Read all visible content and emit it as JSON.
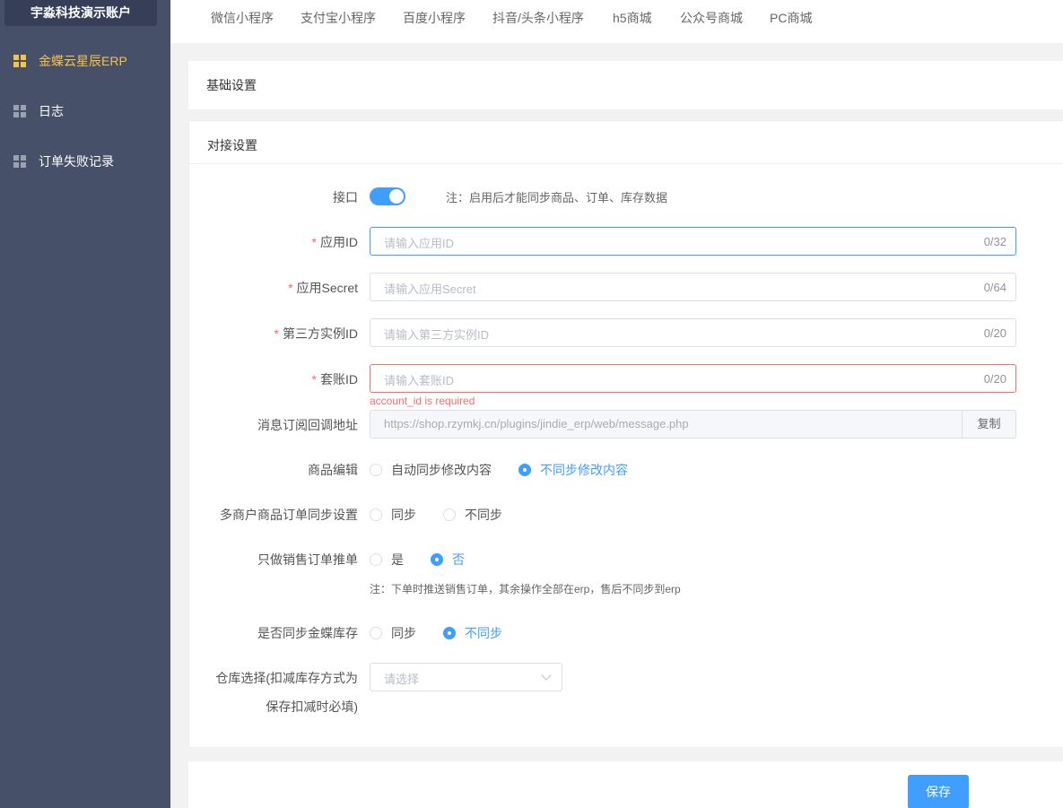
{
  "sidebar": {
    "account": "宇淼科技演示账户",
    "items": [
      {
        "label": "金蝶云星辰ERP"
      },
      {
        "label": "日志"
      },
      {
        "label": "订单失败记录"
      }
    ]
  },
  "tabs": [
    "微信小程序",
    "支付宝小程序",
    "百度小程序",
    "抖音/头条小程序",
    "h5商城",
    "公众号商城",
    "PC商城"
  ],
  "basic": {
    "title": "基础设置"
  },
  "dock": {
    "title": "对接设置",
    "interface": {
      "label": "接口",
      "note": "注：启用后才能同步商品、订单、库存数据"
    },
    "app_id": {
      "label": "应用ID",
      "placeholder": "请输入应用ID",
      "count": "0/32"
    },
    "app_secret": {
      "label": "应用Secret",
      "placeholder": "请输入应用Secret",
      "count": "0/64"
    },
    "instance_id": {
      "label": "第三方实例ID",
      "placeholder": "请输入第三方实例ID",
      "count": "0/20"
    },
    "account_id": {
      "label": "套账ID",
      "placeholder": "请输入套账ID",
      "count": "0/20",
      "error": "account_id is required"
    },
    "callback": {
      "label": "消息订阅回调地址",
      "value": "https://shop.rzymkj.cn/plugins/jindie_erp/web/message.php",
      "copy": "复制"
    },
    "goods_edit": {
      "label": "商品编辑",
      "option1": "自动同步修改内容",
      "option2": "不同步修改内容"
    },
    "multi_merchant": {
      "label": "多商户商品订单同步设置",
      "option1": "同步",
      "option2": "不同步"
    },
    "sale_only": {
      "label": "只做销售订单推单",
      "option1": "是",
      "option2": "否",
      "note": "注：下单时推送销售订单，其余操作全部在erp，售后不同步到erp"
    },
    "sync_stock": {
      "label": "是否同步金蝶库存",
      "option1": "同步",
      "option2": "不同步"
    },
    "warehouse": {
      "label_line1": "仓库选择(扣减库存方式为",
      "label_line2": "保存扣减时必填)",
      "placeholder": "请选择"
    }
  },
  "footer": {
    "save": "保存"
  },
  "colors": {
    "sidebar": "#475069",
    "accent": "#409eff",
    "active_menu": "#f8c244",
    "error": "#f56c6c"
  }
}
